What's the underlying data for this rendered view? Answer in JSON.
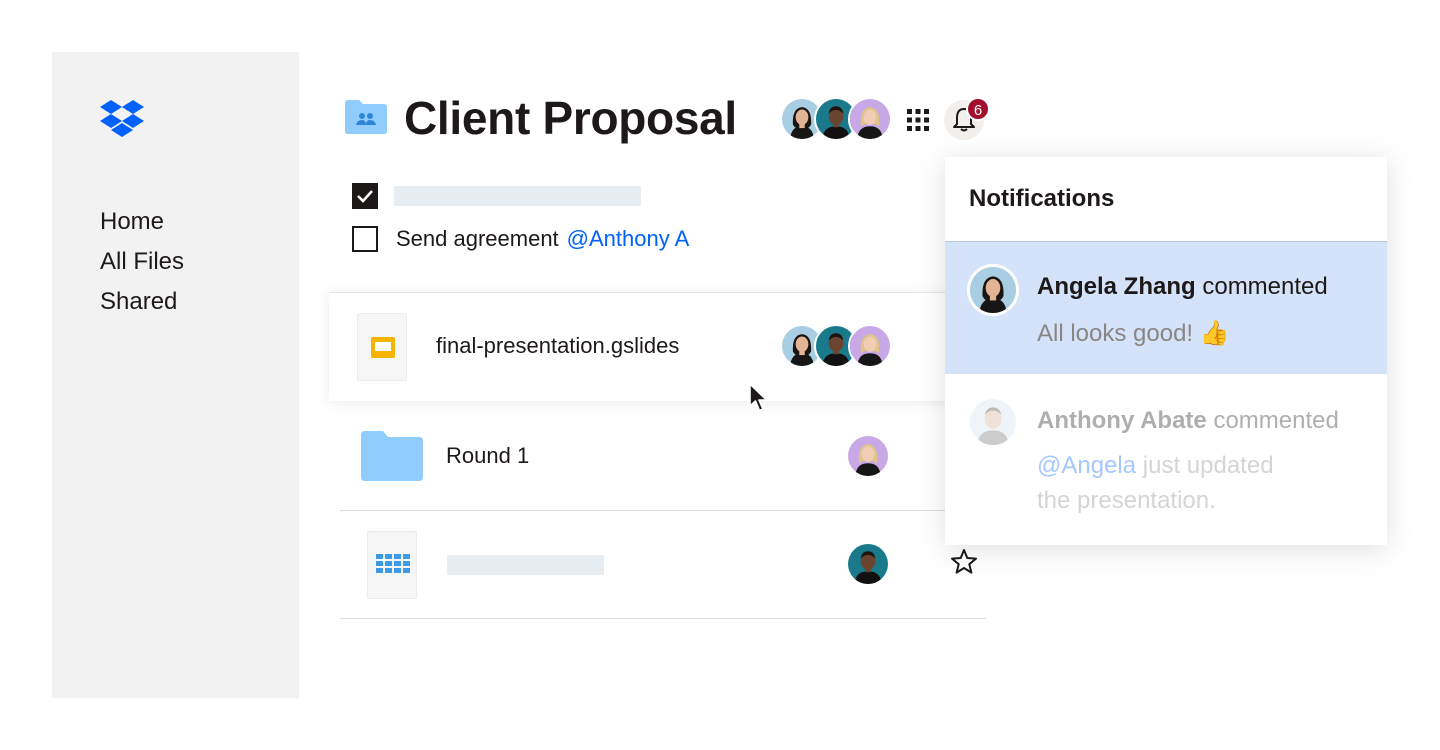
{
  "sidebar": {
    "logo": "dropbox-logo",
    "items": [
      {
        "label": "Home"
      },
      {
        "label": "All Files"
      },
      {
        "label": "Shared"
      }
    ]
  },
  "header": {
    "folder_icon": "shared-folder-icon",
    "title": "Client Proposal",
    "apps_icon": "grid-icon",
    "bell_icon": "bell-icon",
    "notification_count": "6"
  },
  "tasks": [
    {
      "checked": true,
      "text": "",
      "mention": ""
    },
    {
      "checked": false,
      "text": "Send agreement",
      "mention": "@Anthony A"
    }
  ],
  "files": [
    {
      "name": "final-presentation.gslides",
      "icon": "slides-icon"
    },
    {
      "name": "Round 1",
      "icon": "folder-icon"
    },
    {
      "name": "",
      "icon": "spreadsheet-icon",
      "starred": false
    }
  ],
  "notifications": {
    "title": "Notifications",
    "items": [
      {
        "author": "Angela Zhang",
        "action": "commented",
        "message": "All looks good! 👍",
        "mention": "",
        "highlighted": true
      },
      {
        "author": "Anthony Abate",
        "action": "commented",
        "mention": "@Angela",
        "message_lines": [
          "just updated",
          "the presentation."
        ],
        "highlighted": false
      }
    ]
  },
  "colors": {
    "accent": "#0061fe",
    "sidebar_bg": "#f2f2f2",
    "highlight": "#d5e3fa",
    "badge": "#a0102d",
    "folder": "#90cdfd"
  }
}
